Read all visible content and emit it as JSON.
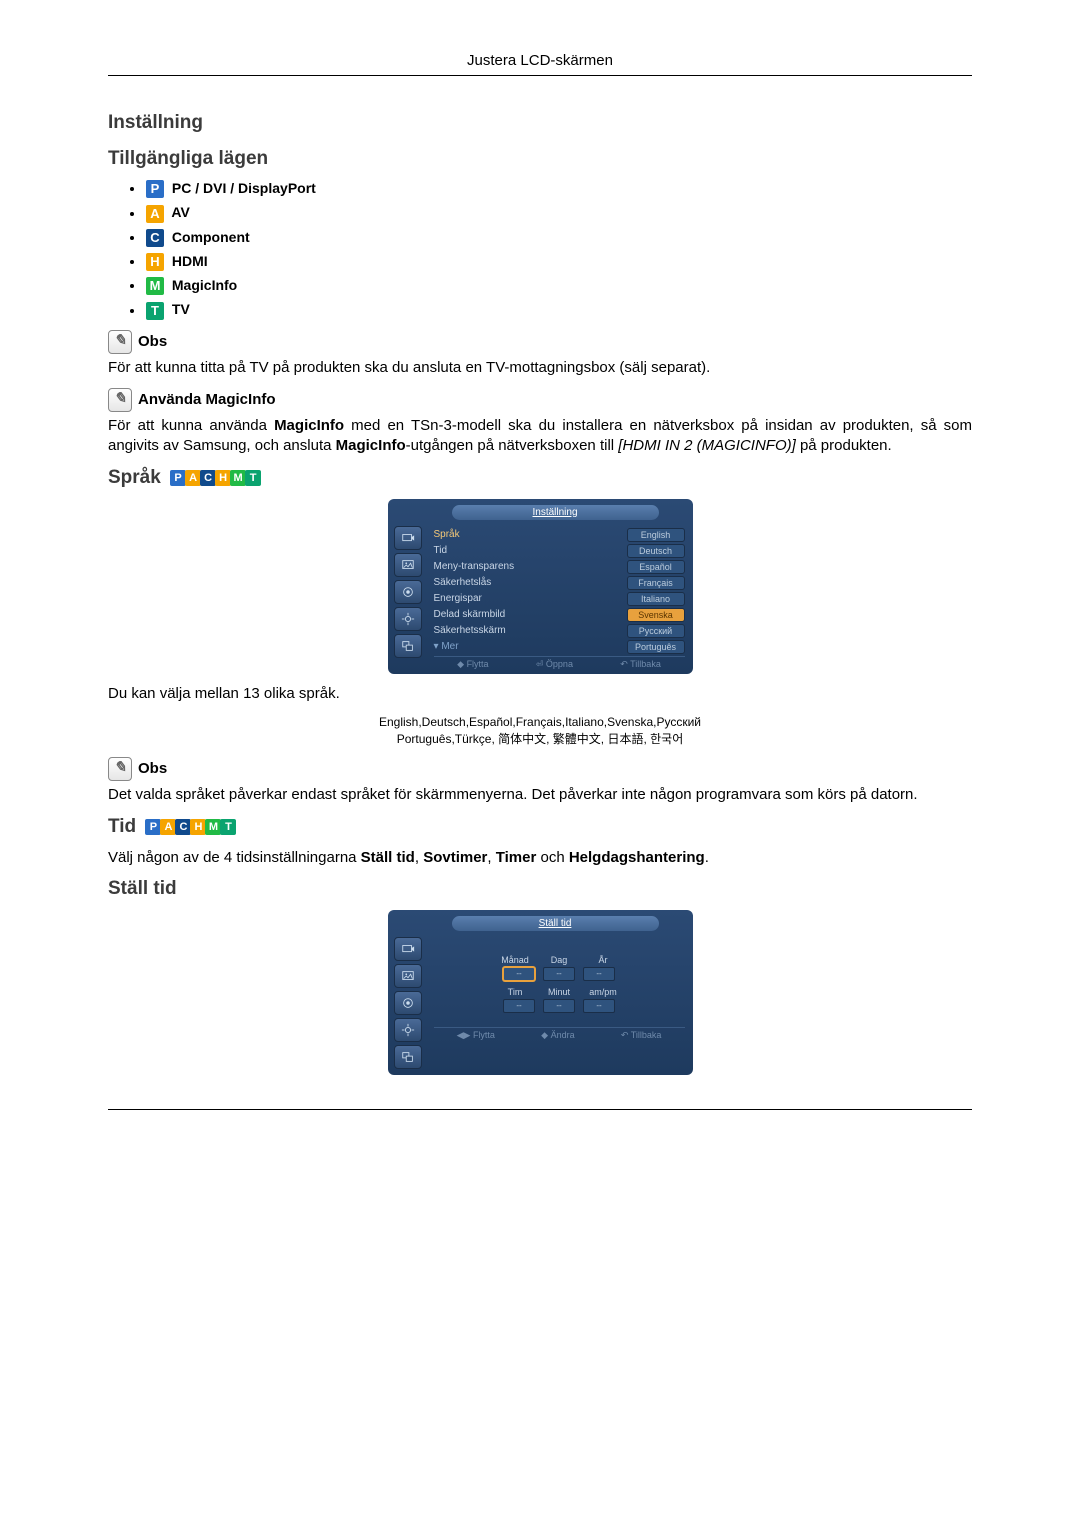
{
  "header": {
    "title": "Justera LCD-skärmen"
  },
  "section_settings": {
    "title": "Inställning"
  },
  "section_modes": {
    "title": "Tillgängliga lägen",
    "items": [
      {
        "icon": "P",
        "label": "PC / DVI / DisplayPort"
      },
      {
        "icon": "A",
        "label": "AV"
      },
      {
        "icon": "C",
        "label": "Component"
      },
      {
        "icon": "H",
        "label": "HDMI"
      },
      {
        "icon": "M",
        "label": "MagicInfo"
      },
      {
        "icon": "T",
        "label": "TV"
      }
    ]
  },
  "notes": {
    "obs1_heading": "Obs",
    "obs1_body": "För att kunna titta på TV på produkten ska du ansluta en TV-mottagningsbox (sälj separat).",
    "magicinfo_heading": "Använda MagicInfo",
    "magicinfo_body_pre": "För att kunna använda ",
    "magicinfo_bold1": "MagicInfo",
    "magicinfo_mid": " med en TSn-3-modell ska du installera en nätverksbox på insidan av produkten, så som angivits av Samsung, och ansluta ",
    "magicinfo_bold2": "MagicInfo",
    "magicinfo_after": "-utgången på nätverksboxen till ",
    "magicinfo_italic": "[HDMI IN 2 (MAGICINFO)]",
    "magicinfo_end": " på produkten."
  },
  "sprak": {
    "title": "Språk",
    "osd_title": "Inställning",
    "menu_items": [
      "Språk",
      "Tid",
      "Meny-transparens",
      "Säkerhetslås",
      "Energispar",
      "Delad skärmbild",
      "Säkerhetsskärm"
    ],
    "lang_options": [
      "English",
      "Deutsch",
      "Español",
      "Français",
      "Italiano",
      "Svenska",
      "Русский",
      "Português"
    ],
    "selected_lang": "Svenska",
    "more_label": "Mer",
    "footer": [
      "Flytta",
      "Öppna",
      "Tillbaka"
    ],
    "body1": "Du kan välja mellan 13 olika språk.",
    "lang_list_line1": "English,Deutsch,Español,Français,Italiano,Svenska,Русский",
    "lang_list_line2": "Português,Türkçe, 简体中文, 繁體中文, 日本語, 한국어",
    "obs_heading": "Obs",
    "obs_body": "Det valda språket påverkar endast språket för skärmmenyerna. Det påverkar inte någon programvara som körs på datorn."
  },
  "tid": {
    "title": "Tid",
    "body_pre": "Välj någon av de 4 tidsinställningarna ",
    "b1": "Ställ tid",
    "sep1": ", ",
    "b2": "Sovtimer",
    "sep2": ", ",
    "b3": "Timer",
    "sep3": " och ",
    "b4": "Helgdagshantering",
    "end": "."
  },
  "stall_tid": {
    "title": "Ställ tid",
    "osd_title": "Ställ tid",
    "row1_labels": [
      "Månad",
      "Dag",
      "År"
    ],
    "row2_labels": [
      "Tim",
      "Minut",
      "am/pm"
    ],
    "field_placeholder": "--",
    "footer": [
      "Flytta",
      "Ändra",
      "Tillbaka"
    ]
  }
}
